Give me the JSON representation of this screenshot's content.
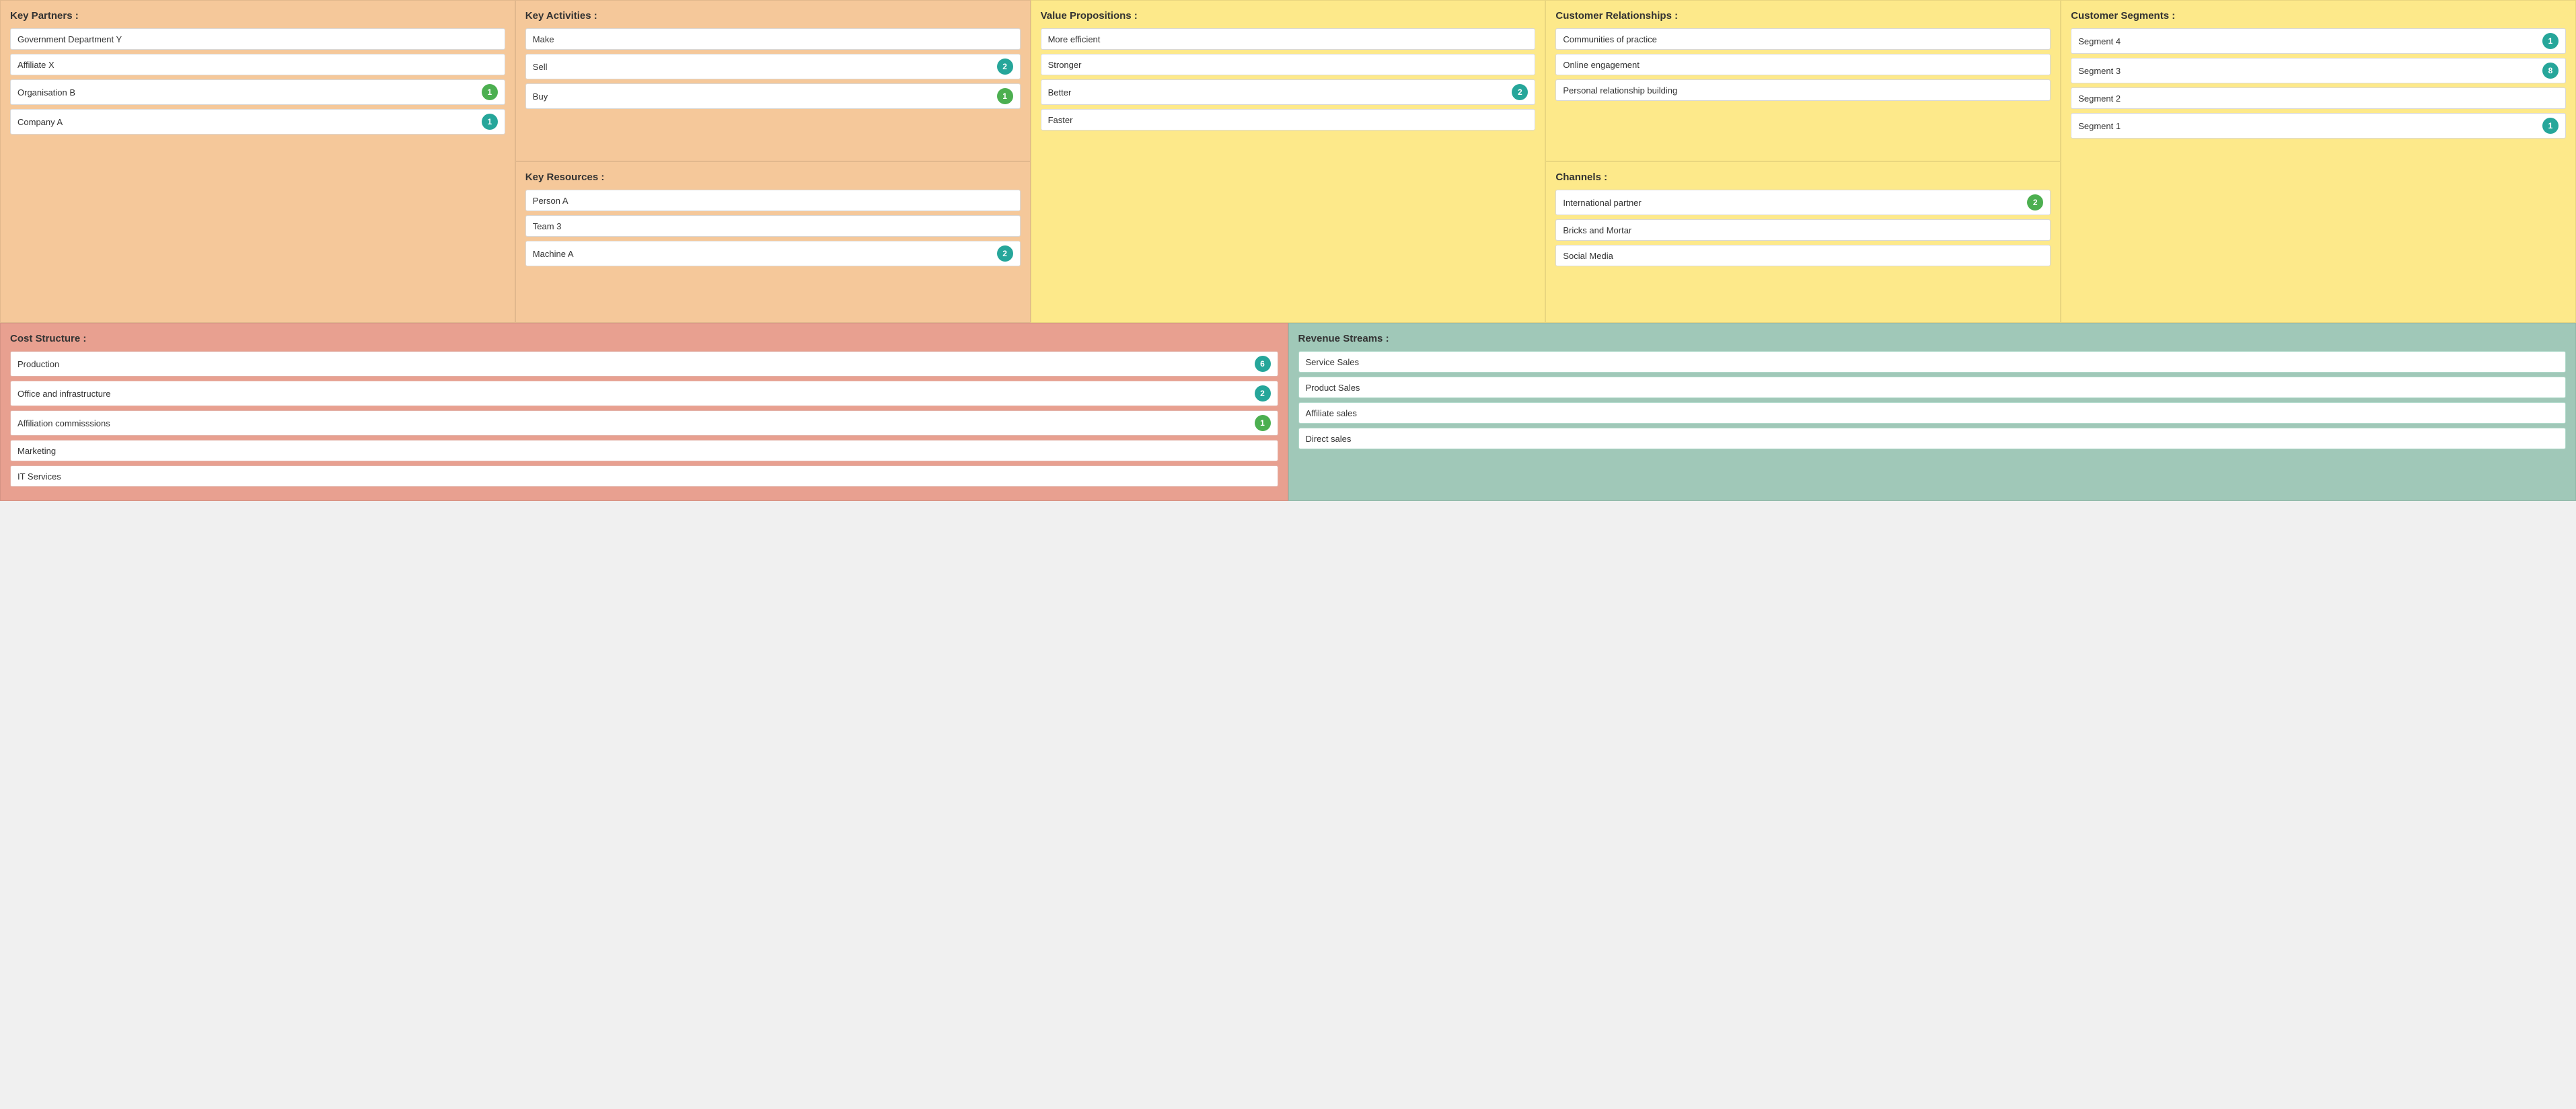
{
  "keyPartners": {
    "title": "Key Partners",
    "items": [
      {
        "label": "Government Department Y",
        "badge": null
      },
      {
        "label": "Affiliate X",
        "badge": null
      },
      {
        "label": "Organisation B",
        "badge": {
          "count": "1",
          "type": "green"
        }
      },
      {
        "label": "Company A",
        "badge": {
          "count": "1",
          "type": "teal"
        }
      }
    ]
  },
  "keyActivities": {
    "title": "Key Activities",
    "items": [
      {
        "label": "Make",
        "badge": null
      },
      {
        "label": "Sell",
        "badge": {
          "count": "2",
          "type": "teal"
        }
      },
      {
        "label": "Buy",
        "badge": {
          "count": "1",
          "type": "green"
        }
      }
    ]
  },
  "keyResources": {
    "title": "Key Resources",
    "items": [
      {
        "label": "Person A",
        "badge": null
      },
      {
        "label": "Team 3",
        "badge": null
      },
      {
        "label": "Machine A",
        "badge": {
          "count": "2",
          "type": "teal"
        }
      }
    ]
  },
  "valuePropositions": {
    "title": "Value Propositions",
    "items": [
      {
        "label": "More efficient",
        "badge": null
      },
      {
        "label": "Stronger",
        "badge": null
      },
      {
        "label": "Better",
        "badge": {
          "count": "2",
          "type": "teal"
        }
      },
      {
        "label": "Faster",
        "badge": null
      }
    ]
  },
  "customerRelationships": {
    "title": "Customer Relationships",
    "items": [
      {
        "label": "Communities of practice",
        "badge": null
      },
      {
        "label": "Online engagement",
        "badge": null
      },
      {
        "label": "Personal relationship building",
        "badge": null
      }
    ]
  },
  "channels": {
    "title": "Channels",
    "items": [
      {
        "label": "International partner",
        "badge": {
          "count": "2",
          "type": "green"
        }
      },
      {
        "label": "Bricks and Mortar",
        "badge": null
      },
      {
        "label": "Social Media",
        "badge": null
      }
    ]
  },
  "customerSegments": {
    "title": "Customer Segments",
    "items": [
      {
        "label": "Segment 4",
        "badge": {
          "count": "1",
          "type": "teal"
        }
      },
      {
        "label": "Segment 3",
        "badge": {
          "count": "8",
          "type": "teal"
        }
      },
      {
        "label": "Segment 2",
        "badge": null
      },
      {
        "label": "Segment 1",
        "badge": {
          "count": "1",
          "type": "teal"
        }
      }
    ]
  },
  "costStructure": {
    "title": "Cost Structure",
    "items": [
      {
        "label": "Production",
        "badge": {
          "count": "6",
          "type": "teal"
        }
      },
      {
        "label": "Office and infrastructure",
        "badge": {
          "count": "2",
          "type": "teal"
        }
      },
      {
        "label": "Affiliation commisssions",
        "badge": {
          "count": "1",
          "type": "green"
        }
      },
      {
        "label": "Marketing",
        "badge": null
      },
      {
        "label": "IT Services",
        "badge": null
      }
    ]
  },
  "revenueStreams": {
    "title": "Revenue Streams",
    "items": [
      {
        "label": "Service Sales",
        "badge": null
      },
      {
        "label": "Product Sales",
        "badge": null
      },
      {
        "label": "Affiliate sales",
        "badge": null
      },
      {
        "label": "Direct sales",
        "badge": null
      }
    ]
  }
}
